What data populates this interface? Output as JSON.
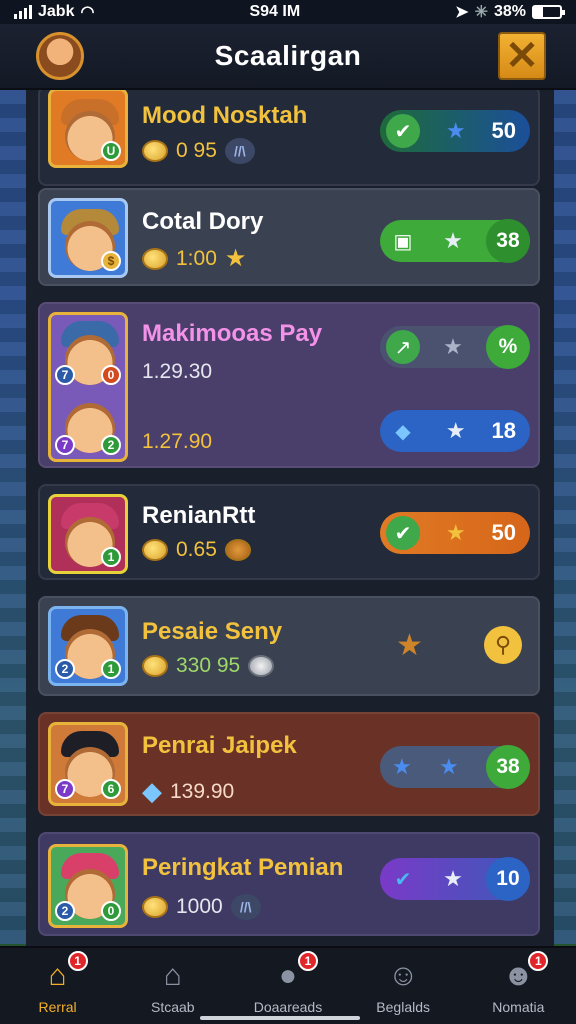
{
  "status_bar": {
    "carrier": "Jabk",
    "time": "S94 IM",
    "battery": "38%"
  },
  "header": {
    "title": "Scaalirgan",
    "close_icon": "close-x-icon",
    "avatar_icon": "player-avatar-icon"
  },
  "players": [
    {
      "name": "Mood Nosktah",
      "value": "0 95",
      "tag": "//\\",
      "pill_icons": [
        "green-check-icon",
        "star-icon"
      ],
      "pill_value": "50",
      "name_color": "#f2c13d"
    },
    {
      "name": "Cotal Dory",
      "value": "1:00",
      "pill_icons": [
        "box-icon",
        "star-icon"
      ],
      "pill_value": "38",
      "name_color": "#ffffff"
    },
    {
      "name": "Makimooas Pay",
      "value": "1.29.30",
      "value2": "1.27.90",
      "pill_icons": [
        "green-arrow-icon",
        "star-icon"
      ],
      "pill_value": "%",
      "pill2_icons": [
        "diamond-icon",
        "star-icon"
      ],
      "pill2_value": "18",
      "name_color": "#f392e8"
    },
    {
      "name": "RenianRtt",
      "value": "0.65",
      "pill_icons": [
        "green-check-icon",
        "star-icon"
      ],
      "pill_value": "50",
      "name_color": "#ffffff"
    },
    {
      "name": "Pesaie Seny",
      "value": "330 95",
      "pill_icons": [
        "star-icon"
      ],
      "pill_value": "",
      "name_color": "#f2c13d"
    },
    {
      "name": "Penrai Jaipek",
      "value": "139.90",
      "pill_icons": [
        "star-icon",
        "star-icon"
      ],
      "pill_value": "38",
      "name_color": "#f2c13d"
    },
    {
      "name": "Peringkat Pemian",
      "value": "1000",
      "tag": "//\\",
      "pill_icons": [
        "blue-check-icon",
        "star-icon"
      ],
      "pill_value": "10",
      "name_color": "#f2c13d"
    }
  ],
  "tabs": [
    {
      "label": "Rerral",
      "icon": "home-icon",
      "badge": "1",
      "active": true
    },
    {
      "label": "Stcaab",
      "icon": "shop-icon",
      "badge": "",
      "active": false
    },
    {
      "label": "Doaareads",
      "icon": "ball-icon",
      "badge": "1",
      "active": false
    },
    {
      "label": "Beglalds",
      "icon": "face-icon",
      "badge": "",
      "active": false
    },
    {
      "label": "Nomatia",
      "icon": "profile-icon",
      "badge": "1",
      "active": false
    }
  ]
}
